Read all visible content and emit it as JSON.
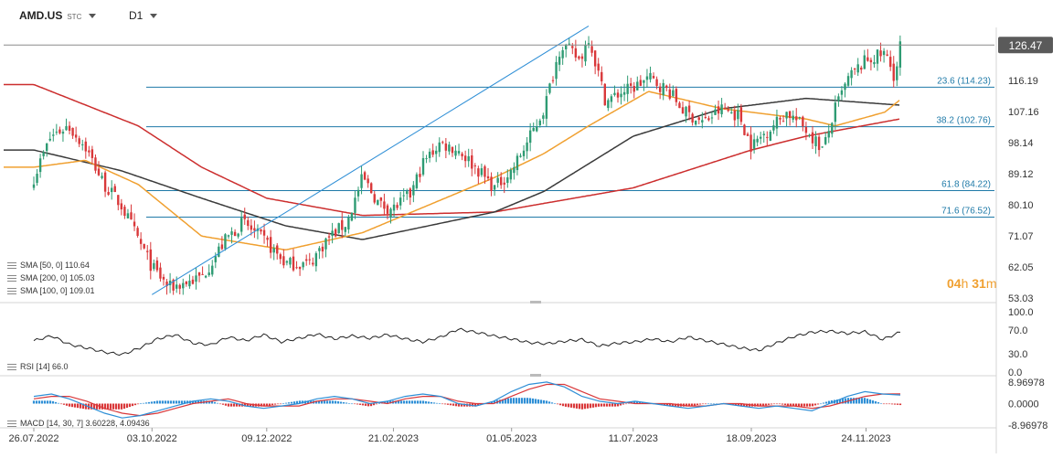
{
  "header": {
    "symbol": "AMD.US",
    "symbol_type": "STC",
    "timeframe": "D1"
  },
  "timer": {
    "hours": "04",
    "h_unit": "h",
    "minutes": "31",
    "m_unit": "m"
  },
  "legend": {
    "sma50": "SMA [50, 0] 110.64",
    "sma200": "SMA [200, 0] 105.03",
    "sma100": "SMA [100, 0] 109.01",
    "rsi": "RSI [14] 66.0",
    "macd": "MACD [14, 30, 7] 3.60228, 4.09436"
  },
  "colors": {
    "up": "#2e9b73",
    "down": "#d9383a",
    "sma50": "#f0a030",
    "sma200": "#cc2e2e",
    "sma100": "#3a3a3a",
    "fib": "#1f7aa8",
    "trend": "#2f8fd6",
    "price_badge": "#5a5a5a",
    "macd_pos": "#2f8fd6",
    "macd_neg": "#d9383a"
  },
  "chart_data": [
    {
      "type": "candlestick",
      "title": "AMD.US",
      "x_tick_labels": [
        "26.07.2022",
        "03.10.2022",
        "09.12.2022",
        "21.02.2023",
        "01.05.2023",
        "11.07.2023",
        "18.09.2023",
        "24.11.2023"
      ],
      "y_tick_labels": [
        "53.03",
        "62.05",
        "71.07",
        "80.10",
        "89.12",
        "98.14",
        "107.16",
        "116.19"
      ],
      "ylim": [
        53.03,
        130
      ],
      "current_price": 126.47,
      "current_price_label": "126.47",
      "fibonacci_levels": [
        {
          "label": "23.6 (114.23)",
          "value": 114.23
        },
        {
          "label": "38.2 (102.76)",
          "value": 102.76
        },
        {
          "label": "61.8 (84.22)",
          "value": 84.22
        },
        {
          "label": "71.6 (76.52)",
          "value": 76.52
        }
      ],
      "trend_line": {
        "from": [
          "03.10.2022",
          54.0
        ],
        "to": [
          "15.06.2023",
          132.0
        ]
      },
      "price_path": [
        {
          "date": "26.07.2022",
          "close": 88
        },
        {
          "date": "05.08.2022",
          "close": 100
        },
        {
          "date": "15.08.2022",
          "close": 103
        },
        {
          "date": "25.08.2022",
          "close": 97
        },
        {
          "date": "05.09.2022",
          "close": 86
        },
        {
          "date": "15.09.2022",
          "close": 80
        },
        {
          "date": "25.09.2022",
          "close": 70
        },
        {
          "date": "03.10.2022",
          "close": 62
        },
        {
          "date": "13.10.2022",
          "close": 56
        },
        {
          "date": "01.11.2022",
          "close": 59
        },
        {
          "date": "15.11.2022",
          "close": 70
        },
        {
          "date": "25.11.2022",
          "close": 75
        },
        {
          "date": "09.12.2022",
          "close": 69
        },
        {
          "date": "20.12.2022",
          "close": 63
        },
        {
          "date": "03.01.2023",
          "close": 63
        },
        {
          "date": "13.01.2023",
          "close": 70
        },
        {
          "date": "25.01.2023",
          "close": 75
        },
        {
          "date": "03.02.2023",
          "close": 88
        },
        {
          "date": "13.02.2023",
          "close": 80
        },
        {
          "date": "21.02.2023",
          "close": 79
        },
        {
          "date": "03.03.2023",
          "close": 83
        },
        {
          "date": "10.03.2023",
          "close": 92
        },
        {
          "date": "20.03.2023",
          "close": 98
        },
        {
          "date": "31.03.2023",
          "close": 96
        },
        {
          "date": "10.04.2023",
          "close": 91
        },
        {
          "date": "21.04.2023",
          "close": 85
        },
        {
          "date": "01.05.2023",
          "close": 90
        },
        {
          "date": "10.05.2023",
          "close": 98
        },
        {
          "date": "20.05.2023",
          "close": 108
        },
        {
          "date": "30.05.2023",
          "close": 127
        },
        {
          "date": "10.06.2023",
          "close": 122
        },
        {
          "date": "15.06.2023",
          "close": 129
        },
        {
          "date": "25.06.2023",
          "close": 110
        },
        {
          "date": "05.07.2023",
          "close": 113
        },
        {
          "date": "11.07.2023",
          "close": 114
        },
        {
          "date": "20.07.2023",
          "close": 117
        },
        {
          "date": "01.08.2023",
          "close": 113
        },
        {
          "date": "10.08.2023",
          "close": 107
        },
        {
          "date": "21.08.2023",
          "close": 104
        },
        {
          "date": "01.09.2023",
          "close": 108
        },
        {
          "date": "11.09.2023",
          "close": 106
        },
        {
          "date": "18.09.2023",
          "close": 97
        },
        {
          "date": "28.09.2023",
          "close": 102
        },
        {
          "date": "09.10.2023",
          "close": 107
        },
        {
          "date": "20.10.2023",
          "close": 102
        },
        {
          "date": "30.10.2023",
          "close": 96
        },
        {
          "date": "06.11.2023",
          "close": 108
        },
        {
          "date": "14.11.2023",
          "close": 117
        },
        {
          "date": "24.11.2023",
          "close": 122
        },
        {
          "date": "05.12.2023",
          "close": 124
        },
        {
          "date": "11.12.2023",
          "close": 117
        },
        {
          "date": "14.12.2023",
          "close": 126.47
        }
      ],
      "sma50": [
        {
          "date": "26.07.2022",
          "value": 91
        },
        {
          "date": "25.08.2022",
          "value": 93
        },
        {
          "date": "25.09.2022",
          "value": 86
        },
        {
          "date": "01.11.2022",
          "value": 71
        },
        {
          "date": "20.12.2022",
          "value": 67
        },
        {
          "date": "03.02.2023",
          "value": 72
        },
        {
          "date": "21.04.2023",
          "value": 88
        },
        {
          "date": "20.05.2023",
          "value": 95
        },
        {
          "date": "15.06.2023",
          "value": 103
        },
        {
          "date": "20.07.2023",
          "value": 113
        },
        {
          "date": "01.09.2023",
          "value": 108
        },
        {
          "date": "20.10.2023",
          "value": 105
        },
        {
          "date": "06.11.2023",
          "value": 103
        },
        {
          "date": "05.12.2023",
          "value": 107
        },
        {
          "date": "14.12.2023",
          "value": 110.64
        }
      ],
      "sma100": [
        {
          "date": "26.07.2022",
          "value": 96
        },
        {
          "date": "15.09.2022",
          "value": 90
        },
        {
          "date": "01.11.2022",
          "value": 82
        },
        {
          "date": "20.12.2022",
          "value": 74
        },
        {
          "date": "03.02.2023",
          "value": 70
        },
        {
          "date": "21.04.2023",
          "value": 78
        },
        {
          "date": "20.05.2023",
          "value": 84
        },
        {
          "date": "11.07.2023",
          "value": 100
        },
        {
          "date": "01.09.2023",
          "value": 108
        },
        {
          "date": "18.09.2023",
          "value": 109
        },
        {
          "date": "20.10.2023",
          "value": 111
        },
        {
          "date": "14.12.2023",
          "value": 109.01
        }
      ],
      "sma200": [
        {
          "date": "26.07.2022",
          "value": 115
        },
        {
          "date": "25.09.2022",
          "value": 103
        },
        {
          "date": "01.11.2022",
          "value": 91
        },
        {
          "date": "09.12.2022",
          "value": 82
        },
        {
          "date": "03.02.2023",
          "value": 77
        },
        {
          "date": "21.04.2023",
          "value": 78
        },
        {
          "date": "11.07.2023",
          "value": 85
        },
        {
          "date": "18.09.2023",
          "value": 96
        },
        {
          "date": "20.10.2023",
          "value": 100
        },
        {
          "date": "14.12.2023",
          "value": 105.03
        }
      ]
    },
    {
      "type": "line",
      "title": "RSI [14]",
      "y_tick_labels": [
        "100.0",
        "70.0",
        "30.0",
        "0.0"
      ],
      "ylim": [
        0,
        100
      ],
      "series": [
        {
          "name": "RSI [14]",
          "values": [
            52,
            60,
            46,
            40,
            33,
            29,
            40,
            55,
            62,
            48,
            45,
            58,
            52,
            62,
            50,
            56,
            63,
            55,
            60,
            56,
            62,
            55,
            50,
            58,
            71,
            66,
            60,
            55,
            49,
            47,
            51,
            54,
            43,
            48,
            50,
            55,
            50,
            58,
            52,
            46,
            40,
            36,
            48,
            59,
            66,
            68,
            64,
            67,
            54,
            66
          ]
        }
      ]
    },
    {
      "type": "line",
      "title": "MACD [14, 30, 7]",
      "y_tick_labels": [
        "8.96978",
        "0.0000",
        "-8.96978"
      ],
      "ylim": [
        -8.96978,
        8.96978
      ],
      "series": [
        {
          "name": "MACD",
          "values": [
            3,
            4,
            2,
            -1,
            -4,
            -6,
            -5,
            -3,
            -1,
            1,
            2,
            1,
            -1,
            -2,
            -1,
            0,
            2,
            3,
            2,
            0,
            1,
            3,
            4,
            3,
            0,
            -1,
            1,
            5,
            8,
            9,
            7,
            3,
            1,
            0,
            1,
            0,
            -1,
            -2,
            -1,
            0,
            -1,
            -2,
            -1,
            -2,
            -3,
            0,
            3,
            5,
            4,
            3.6
          ]
        },
        {
          "name": "Signal",
          "values": [
            2,
            3,
            3,
            1,
            -2,
            -4,
            -5,
            -4,
            -2,
            0,
            1,
            2,
            0,
            -1,
            -1,
            -1,
            1,
            2,
            2,
            1,
            0,
            2,
            3,
            3,
            1,
            0,
            0,
            3,
            6,
            8,
            8,
            5,
            2,
            1,
            0,
            0,
            0,
            -1,
            -1,
            0,
            0,
            -1,
            -1,
            -1,
            -2,
            -1,
            1,
            3,
            4,
            4.1
          ]
        }
      ]
    }
  ]
}
